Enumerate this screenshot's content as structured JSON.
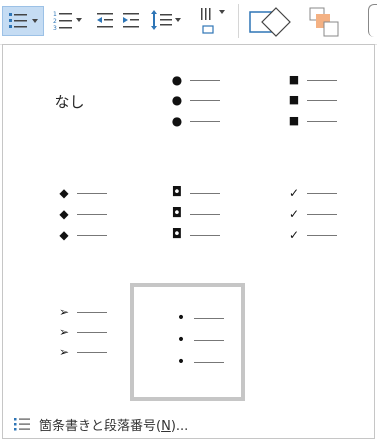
{
  "ribbon": {
    "buttons": [
      {
        "name": "bullets-button",
        "icon": "bullet-list-icon",
        "selected": true,
        "dropdown": true
      },
      {
        "name": "numbering-button",
        "icon": "numbered-list-icon",
        "dropdown": true
      },
      {
        "name": "decrease-indent-button",
        "icon": "decrease-indent-icon"
      },
      {
        "name": "increase-indent-button",
        "icon": "increase-indent-icon"
      },
      {
        "name": "line-spacing-button",
        "icon": "line-spacing-icon",
        "dropdown": true
      },
      {
        "name": "text-direction-button",
        "icon": "text-direction-icon",
        "dropdown": true
      },
      {
        "name": "shapes-button",
        "icon": "shapes-icon"
      },
      {
        "name": "arrange-button",
        "icon": "arrange-icon"
      }
    ]
  },
  "gallery": {
    "none_label": "なし",
    "styles": [
      {
        "name": "bullet-style-none",
        "glyph": "",
        "is_none": true
      },
      {
        "name": "bullet-style-filled-round",
        "glyph": "●"
      },
      {
        "name": "bullet-style-filled-square",
        "glyph": "■"
      },
      {
        "name": "bullet-style-diamond",
        "glyph": "◆"
      },
      {
        "name": "bullet-style-hollow-square",
        "glyph": "◘"
      },
      {
        "name": "bullet-style-checkmark",
        "glyph": "✓"
      },
      {
        "name": "bullet-style-arrowhead",
        "glyph": "➢"
      },
      {
        "name": "bullet-style-small-dot",
        "glyph": "•",
        "selected": true
      }
    ]
  },
  "footer": {
    "label_before": "箇条書きと段落番号(",
    "mnemonic": "N",
    "label_after": ")..."
  },
  "colors": {
    "selected_border": "#c6c6c6",
    "ribbon_selected_bg": "#c5dcf3",
    "accent_blue": "#2e75b6"
  }
}
